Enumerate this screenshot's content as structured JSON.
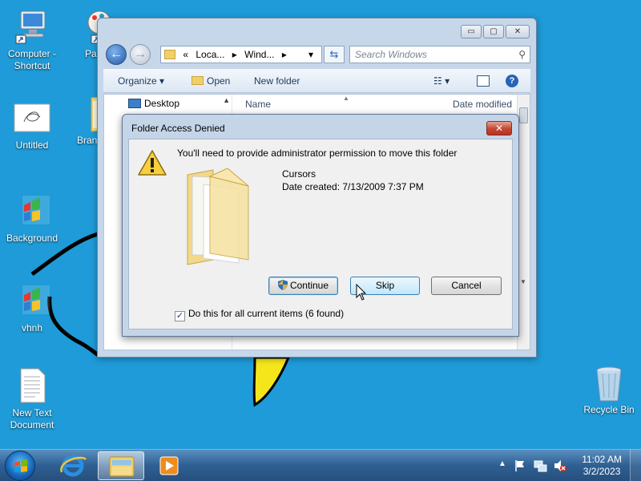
{
  "desktop": {
    "icons": [
      {
        "label_line1": "Computer -",
        "label_line2": "Shortcut",
        "icon": "computer-icon"
      },
      {
        "label_line1": "Pai",
        "label_line2": "",
        "icon": "paint-icon"
      },
      {
        "label_line1": "Untitled",
        "label_line2": "",
        "icon": "drawing-icon"
      },
      {
        "label_line1": "Bran",
        "label_line2": "",
        "icon": "folder-icon"
      },
      {
        "label_line1": "Background",
        "label_line2": "",
        "icon": "program-icon"
      },
      {
        "label_line1": "vhnh",
        "label_line2": "",
        "icon": "program-icon"
      },
      {
        "label_line1": "New Text",
        "label_line2": "Document",
        "icon": "text-document-icon"
      },
      {
        "label_line1": "Recycle Bin",
        "label_line2": "",
        "icon": "recycle-bin-icon"
      }
    ]
  },
  "explorer": {
    "window_buttons": {
      "minimize": "▭",
      "maximize": "▢",
      "close": "✕"
    },
    "address": {
      "chevron": "«",
      "crumb1": "Loca...",
      "sep": "▸",
      "crumb2": "Wind...",
      "sep2": "▸",
      "dropdown": "▾"
    },
    "search": {
      "placeholder": "Search Windows",
      "icon": "search-icon"
    },
    "toolbar": {
      "organize": "Organize ▾",
      "open": "Open",
      "new_folder": "New folder",
      "views": "☷ ▾"
    },
    "nav_pane": {
      "first_item": "Desktop"
    },
    "columns": {
      "name": "Name",
      "date_modified": "Date modified"
    }
  },
  "dialog": {
    "title": "Folder Access Denied",
    "message": "You'll need to provide administrator permission to move this folder",
    "item_name": "Cursors",
    "item_date": "Date created: 7/13/2009 7:37 PM",
    "buttons": {
      "continue": "Continue",
      "skip": "Skip",
      "cancel": "Cancel"
    },
    "checkbox": {
      "label": "Do this for all current items (6 found)",
      "checked": true,
      "mark": "✓"
    }
  },
  "taskbar": {
    "items": [
      "start-orb",
      "internet-explorer-icon",
      "windows-explorer-icon",
      "media-player-icon"
    ],
    "clock": {
      "time": "11:02 AM",
      "date": "3/2/2023"
    }
  },
  "colors": {
    "desktop_bg": "#1e9bd8",
    "window_frame": "#c6d7ea",
    "dialog_close": "#c44532",
    "taskbar": "#2f5f93"
  }
}
